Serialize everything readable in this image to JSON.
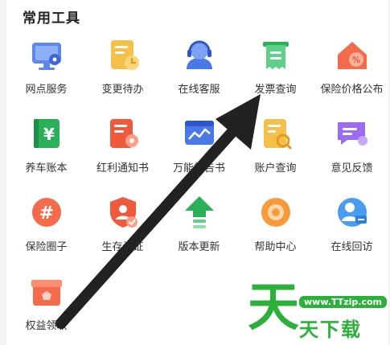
{
  "section_title": "常用工具",
  "tools": [
    {
      "label": "网点服务",
      "icon": "branch-map-icon"
    },
    {
      "label": "变更待办",
      "icon": "change-todo-icon"
    },
    {
      "label": "在线客服",
      "icon": "customer-service-icon"
    },
    {
      "label": "发票查询",
      "icon": "invoice-icon"
    },
    {
      "label": "保险价格公布",
      "icon": "price-tag-icon"
    },
    {
      "label": "养车账本",
      "icon": "ledger-icon"
    },
    {
      "label": "红利通知书",
      "icon": "dividend-notice-icon"
    },
    {
      "label": "万能报告书",
      "icon": "report-chart-icon"
    },
    {
      "label": "账户查询",
      "icon": "account-search-icon"
    },
    {
      "label": "意见反馈",
      "icon": "feedback-icon"
    },
    {
      "label": "保险圈子",
      "icon": "hashtag-icon"
    },
    {
      "label": "生存认证",
      "icon": "certification-shield-icon"
    },
    {
      "label": "版本更新",
      "icon": "update-arrow-icon"
    },
    {
      "label": "帮助中心",
      "icon": "help-center-icon"
    },
    {
      "label": "在线回访",
      "icon": "callback-icon"
    },
    {
      "label": "权益领取",
      "icon": "benefit-box-icon"
    }
  ],
  "colors": {
    "blue": "#4a78e6",
    "yellow": "#f5b938",
    "green": "#2bb03a",
    "red": "#ef5a3c",
    "purple": "#9b6cf0",
    "orange": "#f59b3d",
    "arrow": "#222222"
  },
  "watermark": {
    "big_char": "天",
    "url": "www.TTzip.com",
    "text": "天下载"
  }
}
